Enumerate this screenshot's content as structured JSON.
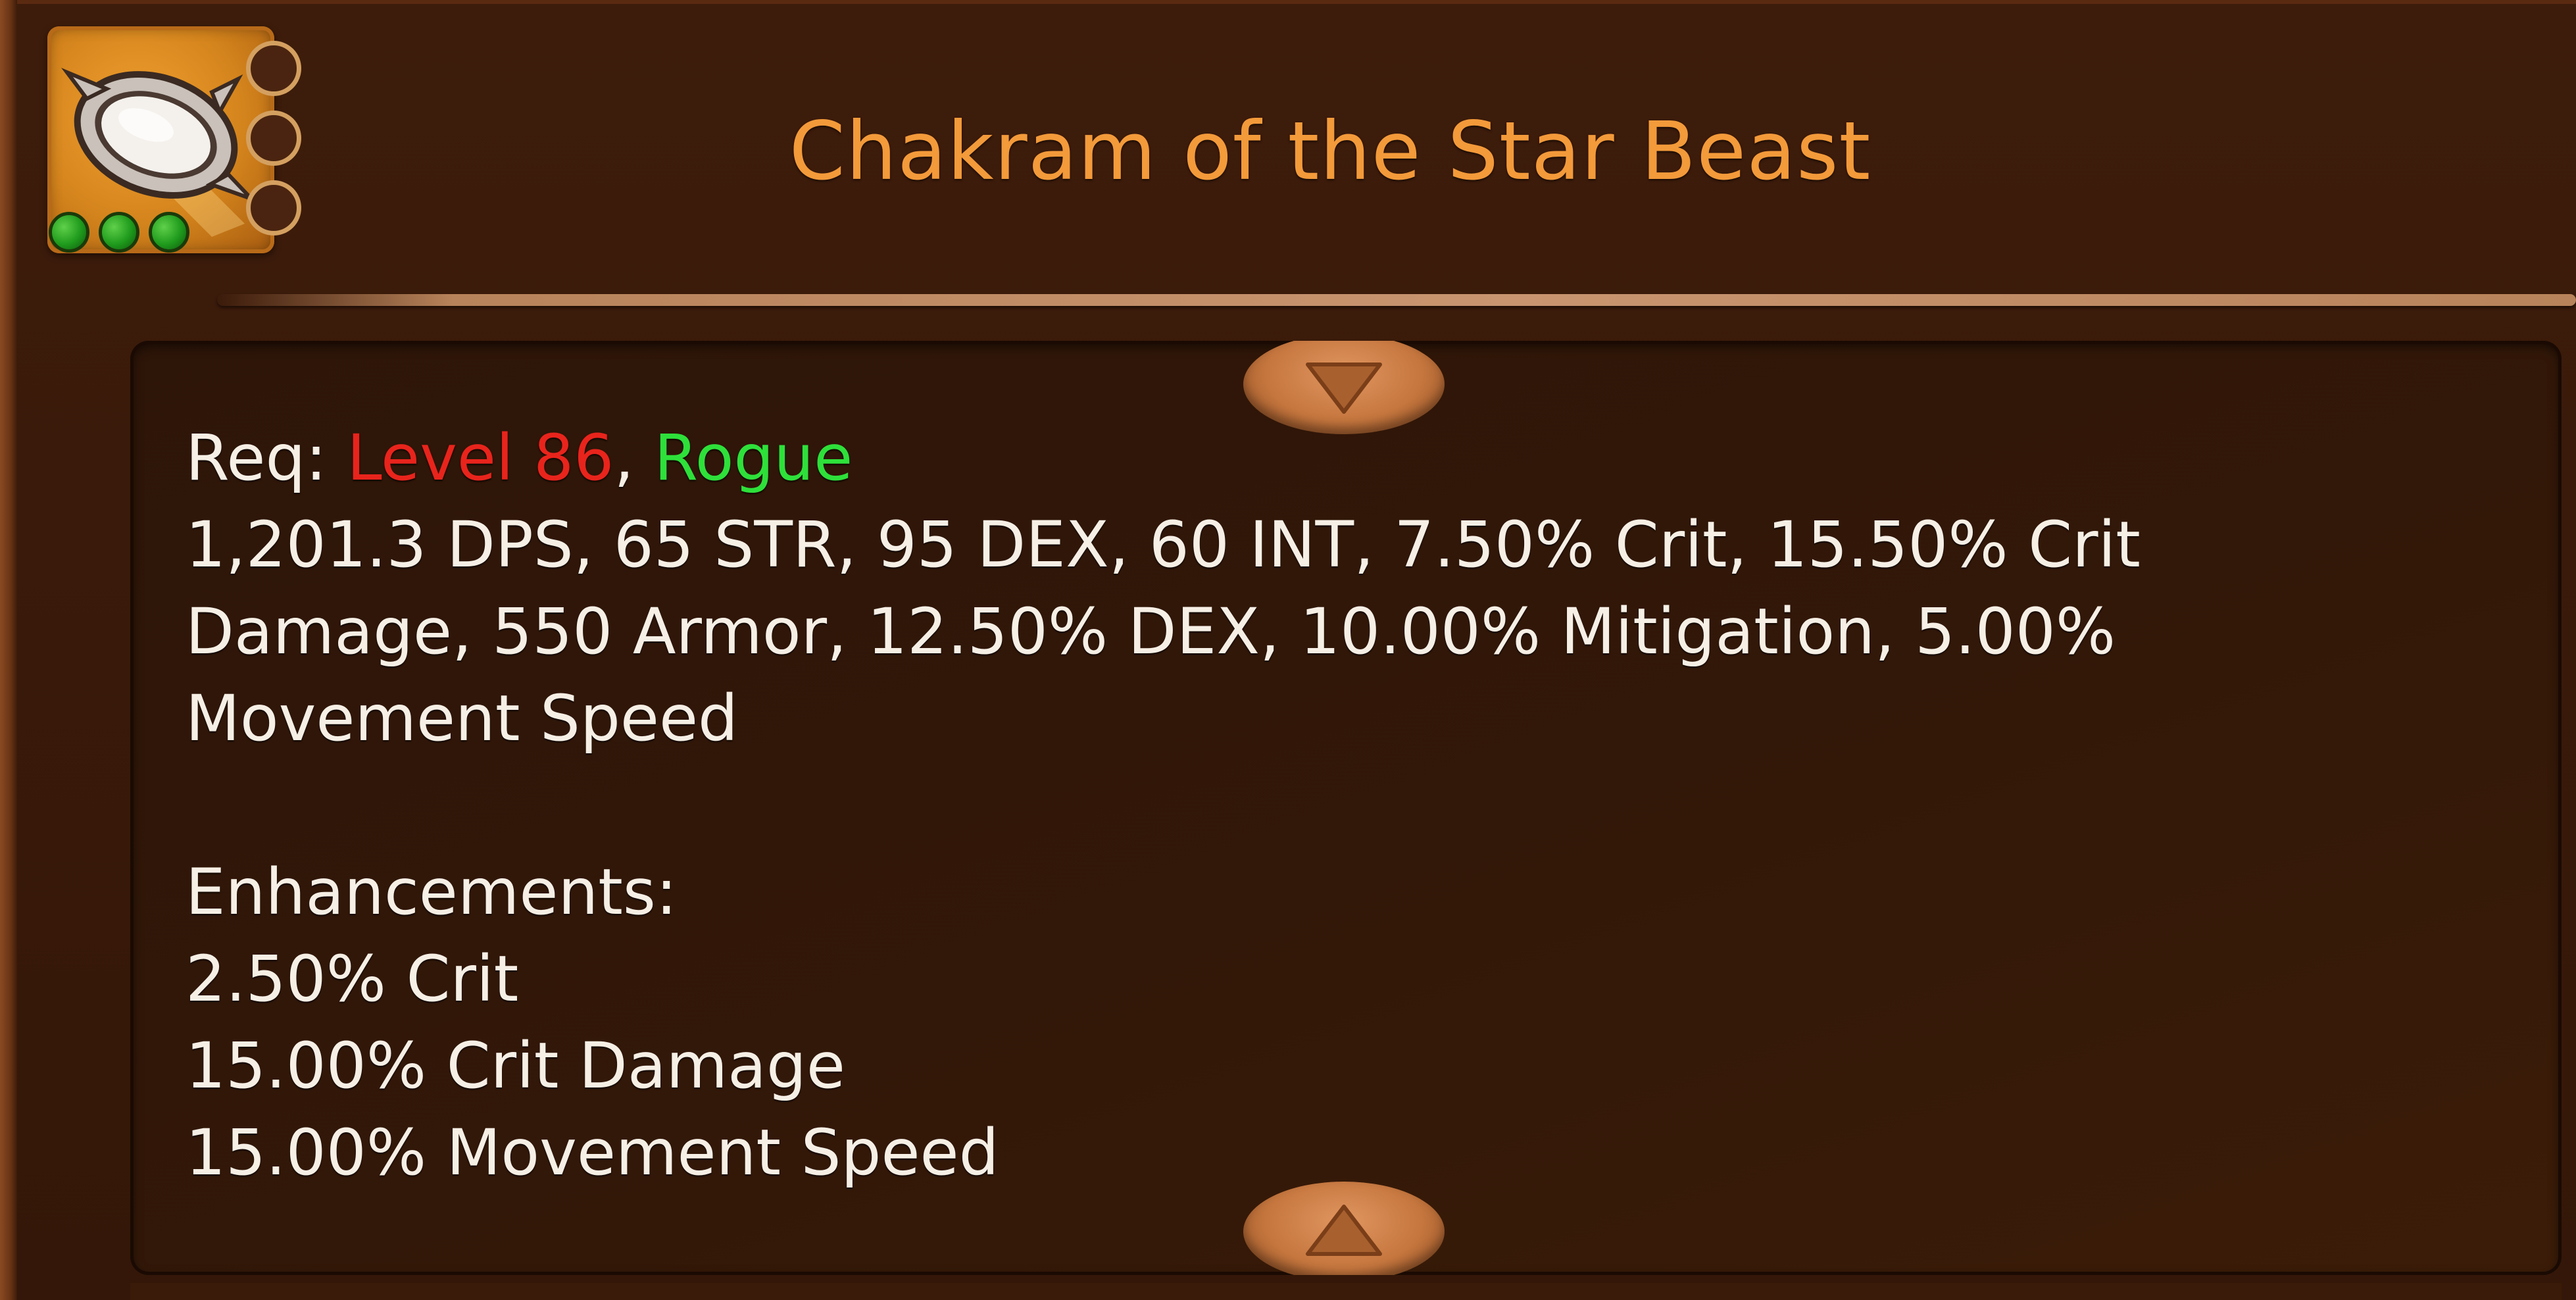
{
  "tooltip": {
    "title": "Chakram of the Star Beast",
    "icon": "chakram-item-icon",
    "sockets_empty": 3,
    "gems_filled": 3,
    "requirements": {
      "prefix": "Req: ",
      "level": "Level 86",
      "separator": ", ",
      "class": "Rogue"
    },
    "stats_lines": [
      "1,201.3 DPS, 65 STR, 95 DEX, 60 INT, 7.50% Crit, 15.50% Crit",
      "Damage, 550 Armor, 12.50% DEX, 10.00% Mitigation, 5.00%",
      "Movement Speed"
    ],
    "enhancements_header": "Enhancements:",
    "enhancements": [
      "2.50% Crit",
      "15.00% Crit Damage",
      "15.00% Movement Speed"
    ],
    "colors": {
      "title": "#f39a3a",
      "requirement_unmet": "#e8241c",
      "requirement_met": "#2ee03a",
      "text": "#f6efe6",
      "gem": "#1f9a1c"
    }
  }
}
